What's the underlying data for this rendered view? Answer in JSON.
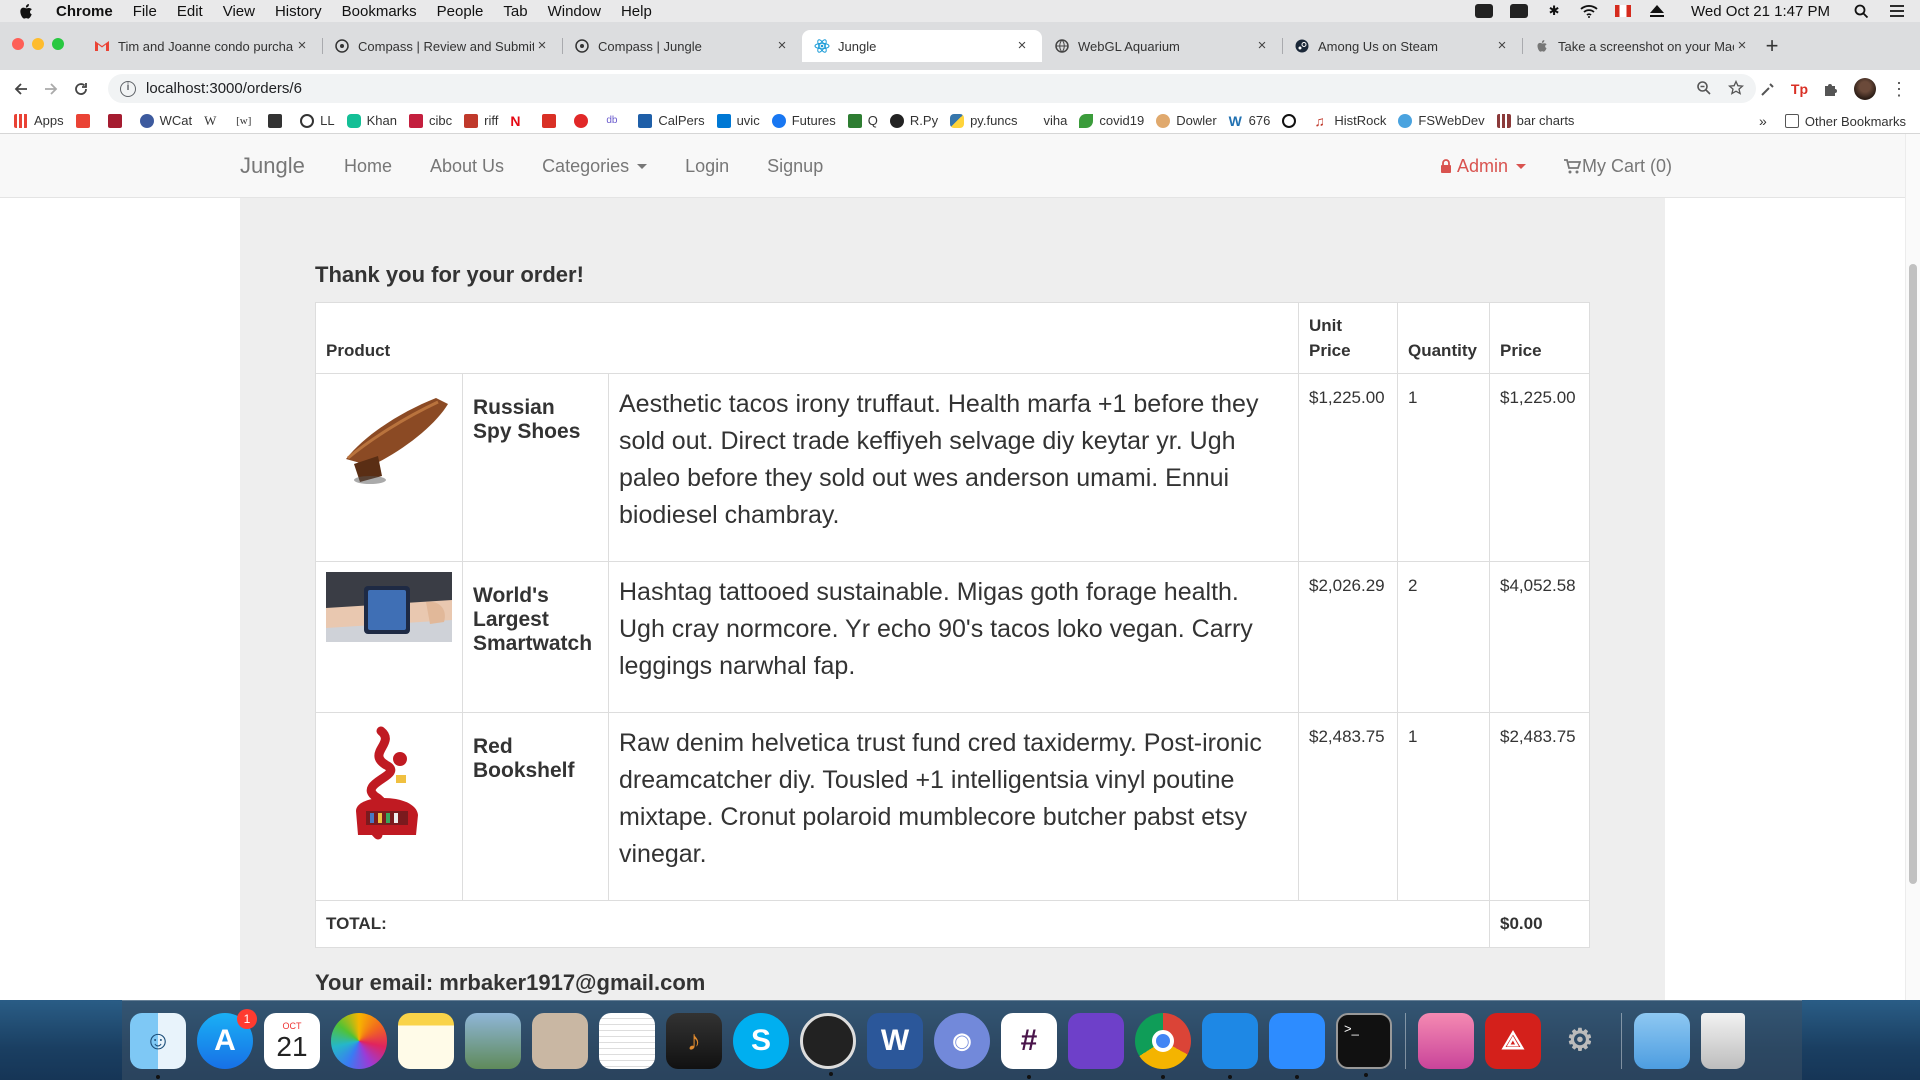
{
  "menubar": {
    "items": [
      "Chrome",
      "File",
      "Edit",
      "View",
      "History",
      "Bookmarks",
      "People",
      "Tab",
      "Window",
      "Help"
    ],
    "clock": "Wed Oct 21  1:47 PM"
  },
  "tabs": [
    {
      "title": "Tim and Joanne condo purcha",
      "icon": "gmail-icon"
    },
    {
      "title": "Compass | Review and Submit",
      "icon": "compass-icon"
    },
    {
      "title": "Compass | Jungle",
      "icon": "compass-icon"
    },
    {
      "title": "Jungle",
      "icon": "react-icon"
    },
    {
      "title": "WebGL Aquarium",
      "icon": "globe-icon"
    },
    {
      "title": "Among Us on Steam",
      "icon": "steam-icon"
    },
    {
      "title": "Take a screenshot on your Mac",
      "icon": "apple-icon"
    }
  ],
  "omnibox": {
    "url": "localhost:3000/orders/6"
  },
  "bookmarks": {
    "items": [
      "Apps",
      "",
      "",
      "WCat",
      "",
      "",
      "",
      "LL",
      "Khan",
      "cibc",
      "riff",
      "",
      "",
      "",
      "",
      "CalPers",
      "uvic",
      "Futures",
      "Q",
      "R.Py",
      "py.funcs",
      "viha",
      "covid19",
      "Dowler",
      "676",
      "",
      "HistRock",
      "FSWebDev",
      "bar charts"
    ],
    "other": "Other Bookmarks",
    "overflow": "»"
  },
  "site_nav": {
    "brand": "Jungle",
    "links": [
      "Home",
      "About Us",
      "Categories",
      "Login",
      "Signup"
    ],
    "admin": "Admin",
    "cart": "My Cart (0)"
  },
  "order": {
    "heading": "Thank you for your order!",
    "columns": [
      "Product",
      "Unit Price",
      "Quantity",
      "Price"
    ],
    "items": [
      {
        "name": "Russian Spy Shoes",
        "description": "Aesthetic tacos irony truffaut. Health marfa +1 before they sold out. Direct trade keffiyeh selvage diy keytar yr. Ugh paleo before they sold out wes anderson umami. Ennui biodiesel chambray.",
        "unit_price": "$1,225.00",
        "quantity": "1",
        "price": "$1,225.00"
      },
      {
        "name": "World's Largest Smartwatch",
        "description": "Hashtag tattooed sustainable. Migas goth forage health. Ugh cray normcore. Yr echo 90's tacos loko vegan. Carry leggings narwhal fap.",
        "unit_price": "$2,026.29",
        "quantity": "2",
        "price": "$4,052.58"
      },
      {
        "name": "Red Bookshelf",
        "description": "Raw denim helvetica trust fund cred taxidermy. Post-ironic dreamcatcher diy. Tousled +1 intelligentsia vinyl poutine mixtape. Cronut polaroid mumblecore butcher pabst etsy vinegar.",
        "unit_price": "$2,483.75",
        "quantity": "1",
        "price": "$2,483.75"
      }
    ],
    "total_label": "TOTAL:",
    "total_value": "$0.00",
    "email_line": "Your email: mrbaker1917@gmail.com"
  },
  "dock": {
    "apps": [
      "finder",
      "app-store",
      "calendar",
      "photos",
      "notes",
      "preview",
      "calculator",
      "textedit",
      "garageband",
      "skype",
      "obs",
      "word",
      "discord",
      "slack",
      "github-desktop",
      "chrome",
      "vscode",
      "zoom",
      "terminal",
      "screen-sharing",
      "acrobat",
      "automator",
      "applications-folder",
      "trash"
    ],
    "app_store_badge": "1",
    "calendar_month": "OCT",
    "calendar_day": "21"
  },
  "colors": {
    "admin_red": "#d9534f",
    "nav_gray": "#777777",
    "page_bg": "#eeeeee"
  }
}
